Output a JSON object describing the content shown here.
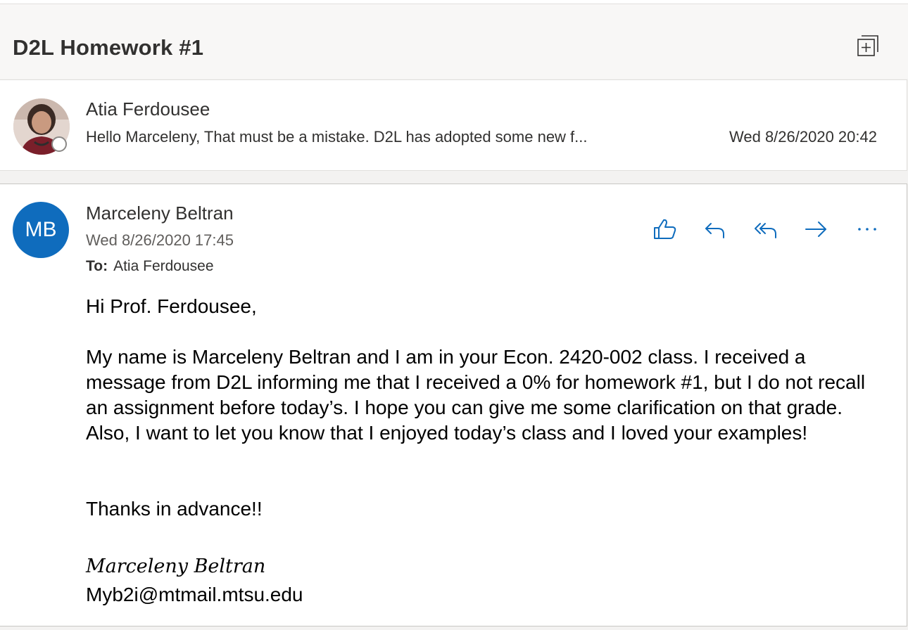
{
  "thread": {
    "subject": "D2L Homework #1"
  },
  "collapsed_message": {
    "sender": "Atia Ferdousee",
    "preview": "Hello Marceleny, That must be a mistake. D2L has adopted some new f...",
    "date": "Wed 8/26/2020 20:42"
  },
  "expanded_message": {
    "avatar_initials": "MB",
    "sender": "Marceleny Beltran",
    "date": "Wed 8/26/2020 17:45",
    "to_label": "To:",
    "to": "Atia Ferdousee",
    "body": {
      "greeting": "Hi Prof. Ferdousee,",
      "paragraph": "My name is Marceleny Beltran and I am in your Econ. 2420-002 class. I received a message from D2L informing me that I received a 0% for homework #1, but I do not recall an assignment before today’s. I hope you can give me some clarification on that grade. Also, I want to let you know that I enjoyed today’s class and I loved your examples!",
      "thanks": "Thanks in advance!!",
      "signature": "Marceleny Beltran",
      "email": "Myb2i@mtmail.mtsu.edu"
    }
  },
  "colors": {
    "accent": "#0f6cbd",
    "background": "#f3f2f1"
  },
  "icons": [
    "popout-icon",
    "like-icon",
    "reply-icon",
    "reply-all-icon",
    "forward-icon",
    "more-actions-icon"
  ]
}
